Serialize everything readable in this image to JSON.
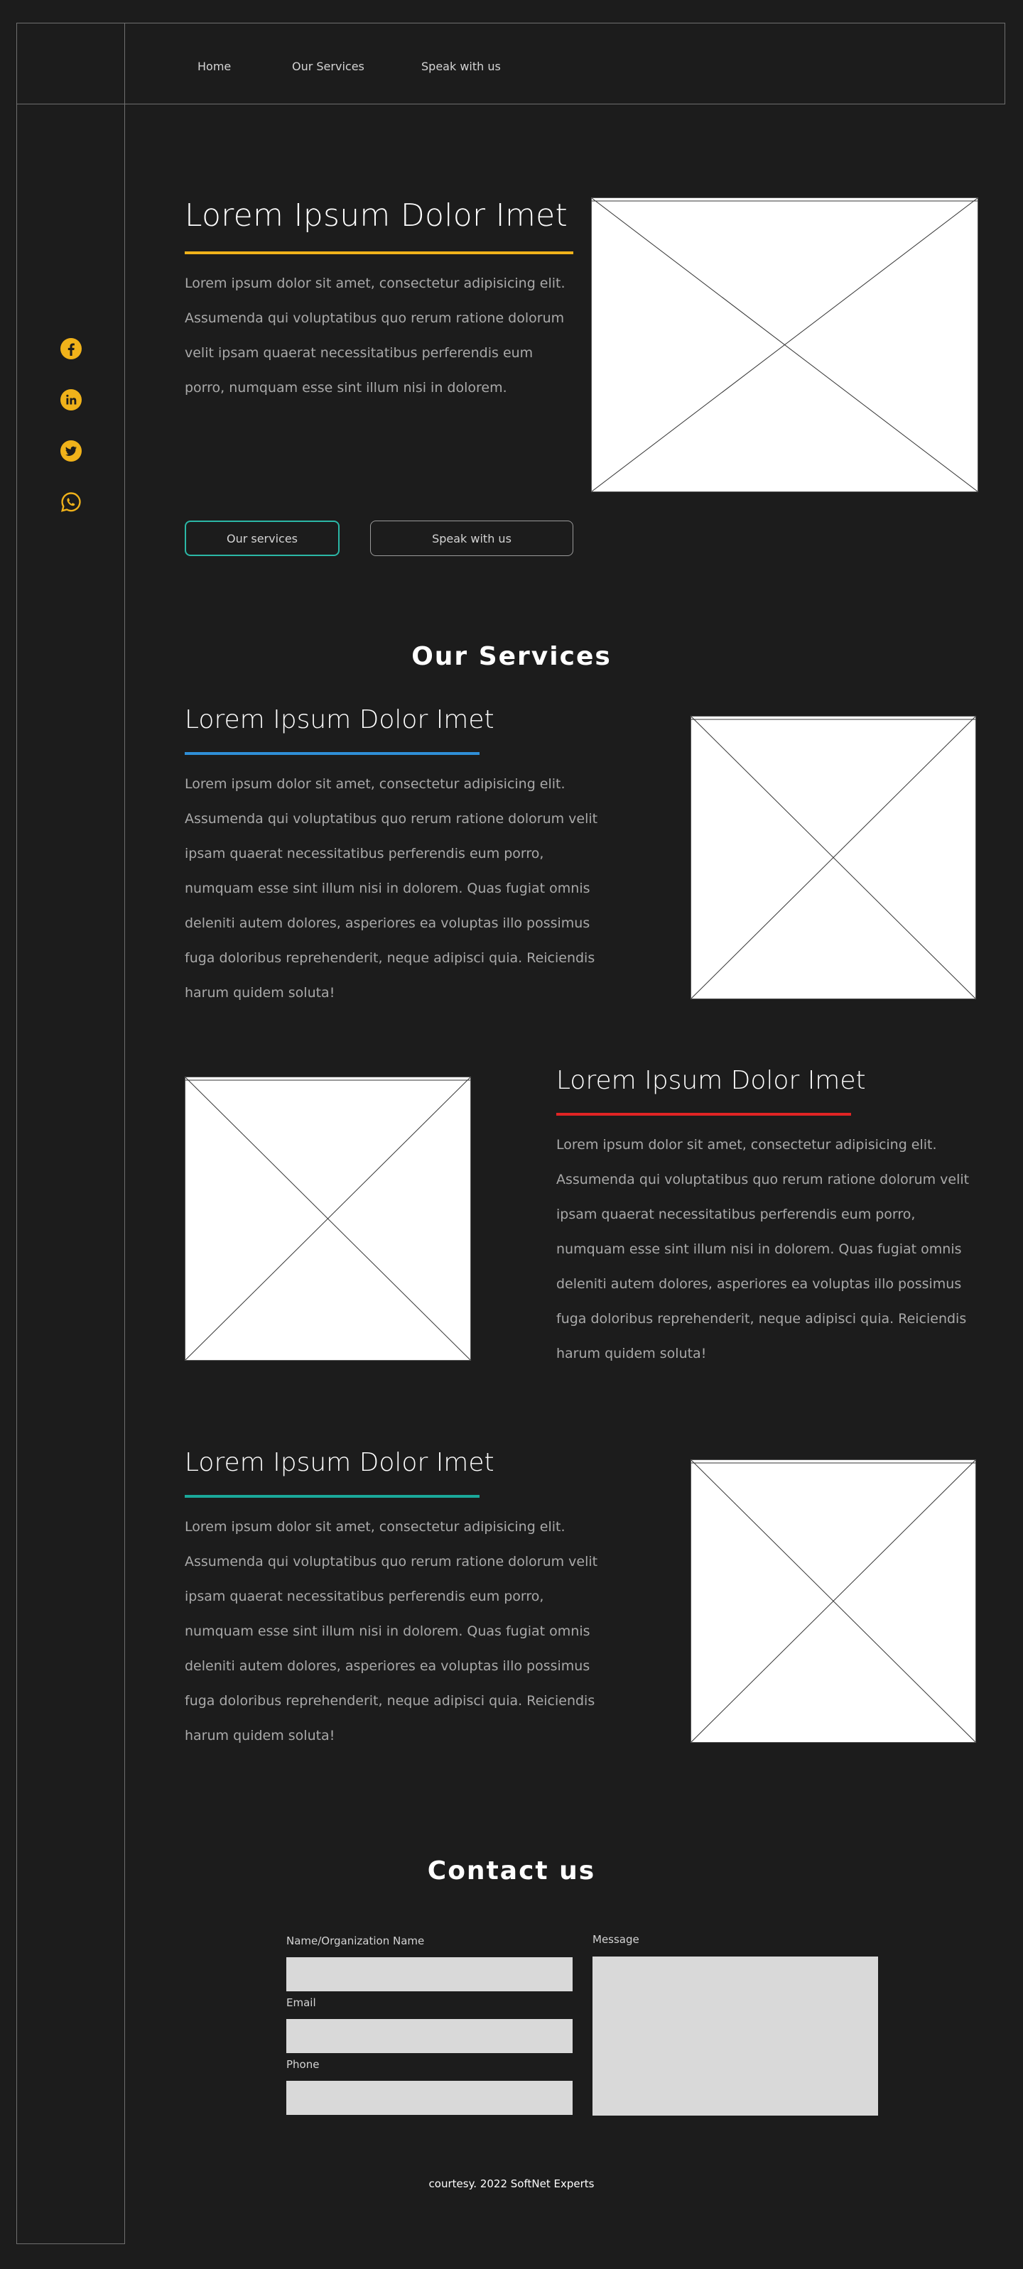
{
  "nav": {
    "items": [
      {
        "label": "Home"
      },
      {
        "label": "Our Services"
      },
      {
        "label": "Speak with us"
      }
    ]
  },
  "social": {
    "icons": [
      "facebook-icon",
      "linkedin-icon",
      "twitter-icon",
      "whatsapp-icon"
    ],
    "color": "#f0b21a"
  },
  "hero": {
    "title": "Lorem Ipsum Dolor Imet",
    "underline_color": "#f0b21a",
    "paragraph": "Lorem ipsum dolor sit amet, consectetur adipisicing elit. Assumenda qui voluptatibus quo rerum ratione dolorum velit ipsam quaerat necessitatibus perferendis eum porro, numquam esse sint illum nisi in dolorem.",
    "primary_button": "Our services",
    "primary_button_color": "#2bb7a6",
    "secondary_button": "Speak with us"
  },
  "services": {
    "heading": "Our Services",
    "items": [
      {
        "title": "Lorem Ipsum Dolor Imet",
        "underline_color": "#2f8fd8",
        "paragraph": "Lorem ipsum dolor sit amet, consectetur adipisicing elit. Assumenda qui voluptatibus quo rerum ratione dolorum velit ipsam quaerat necessitatibus perferendis eum porro, numquam esse sint illum nisi in dolorem. Quas fugiat omnis deleniti autem dolores, asperiores ea voluptas illo possimus fuga doloribus reprehenderit, neque adipisci quia. Reiciendis harum quidem soluta!"
      },
      {
        "title": "Lorem Ipsum Dolor Imet",
        "underline_color": "#e02424",
        "paragraph": "Lorem ipsum dolor sit amet, consectetur adipisicing elit. Assumenda qui voluptatibus quo rerum ratione dolorum velit ipsam quaerat necessitatibus perferendis eum porro, numquam esse sint illum nisi in dolorem. Quas fugiat omnis deleniti autem dolores, asperiores ea voluptas illo possimus fuga doloribus reprehenderit, neque adipisci quia. Reiciendis harum quidem soluta!"
      },
      {
        "title": "Lorem Ipsum Dolor Imet",
        "underline_color": "#1aa89a",
        "paragraph": "Lorem ipsum dolor sit amet, consectetur adipisicing elit. Assumenda qui voluptatibus quo rerum ratione dolorum velit ipsam quaerat necessitatibus perferendis eum porro, numquam esse sint illum nisi in dolorem. Quas fugiat omnis deleniti autem dolores, asperiores ea voluptas illo possimus fuga doloribus reprehenderit, neque adipisci quia. Reiciendis harum quidem soluta!"
      }
    ]
  },
  "contact": {
    "heading": "Contact us",
    "name_label": "Name/Organization Name",
    "email_label": "Email",
    "phone_label": "Phone",
    "message_label": "Message",
    "name_value": "",
    "email_value": "",
    "phone_value": "",
    "message_value": ""
  },
  "footer": {
    "text": "courtesy. 2022  SoftNet Experts"
  }
}
